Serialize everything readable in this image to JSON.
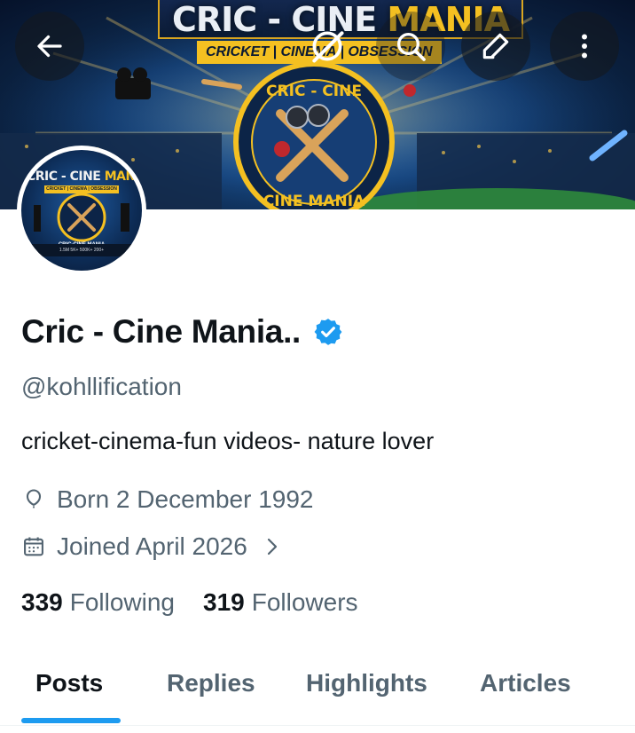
{
  "banner": {
    "title_main": "CRIC - CINE ",
    "title_accent": "MANIA",
    "subtitle": "CRICKET | CINEMA | OBSESSION",
    "badge_top": "CRIC - CINE",
    "badge_bottom": "CINE MANIA"
  },
  "top_bar": {
    "back_icon": "arrow-left-icon",
    "grok_icon": "grok-icon",
    "search_icon": "search-icon",
    "edit_icon": "pencil-icon",
    "more_icon": "more-vertical-icon"
  },
  "avatar": {
    "title_main": "CRIC - CINE ",
    "title_accent": "MANIA",
    "subtitle": "CRICKET | CINEMA | OBSESSION",
    "mid_text": "CRIC-CINE MANIA",
    "footer_text": "1.5M   5K+   500K+   200+"
  },
  "profile": {
    "display_name": "Cric - Cine Mania..",
    "verified": true,
    "handle": "@kohllification",
    "bio": "cricket-cinema-fun videos- nature lover",
    "born": "Born 2 December 1992",
    "joined": "Joined April 2026",
    "following_count": "339",
    "following_label": "Following",
    "followers_count": "319",
    "followers_label": "Followers"
  },
  "tabs": [
    {
      "label": "Posts",
      "active": true
    },
    {
      "label": "Replies",
      "active": false
    },
    {
      "label": "Highlights",
      "active": false
    },
    {
      "label": "Articles",
      "active": false
    }
  ],
  "colors": {
    "accent_blue": "#1d9bf0",
    "text_primary": "#0f1419",
    "text_secondary": "#536471",
    "banner_gold": "#f4c021"
  }
}
